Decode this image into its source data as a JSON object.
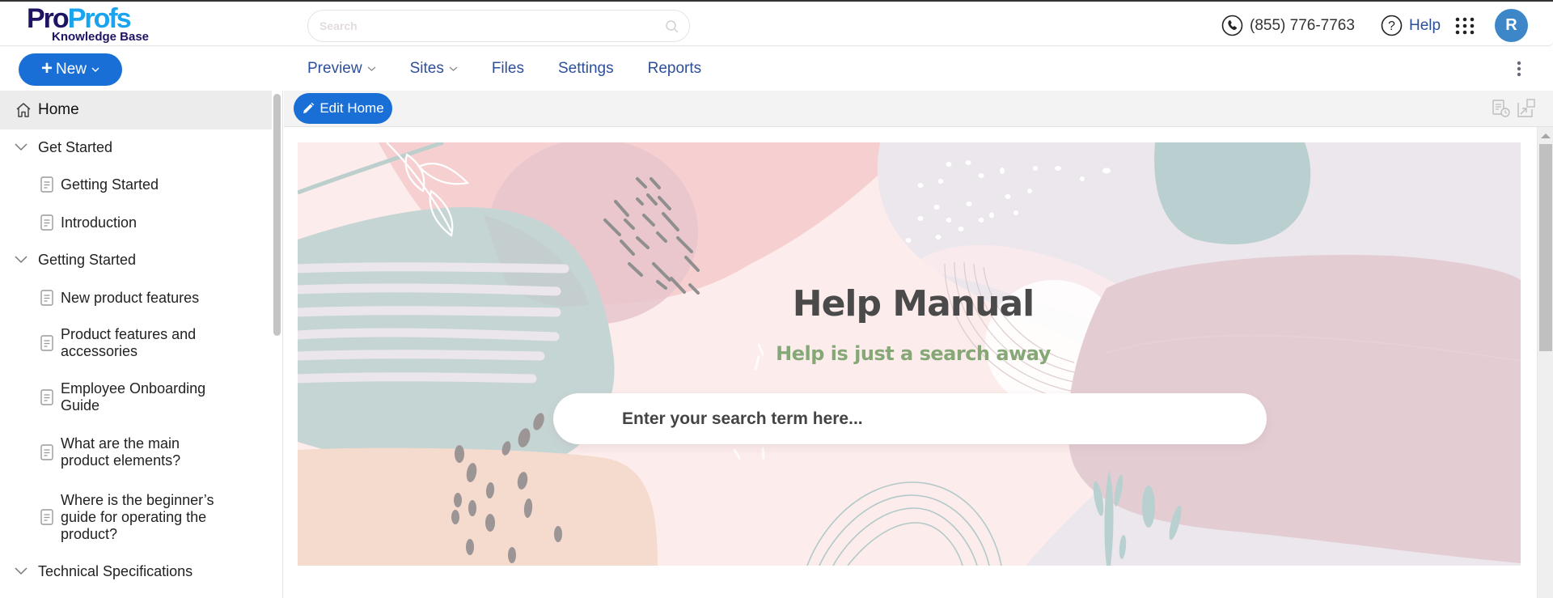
{
  "app": {
    "logo": {
      "part1": "Pro",
      "part2": "Profs",
      "subtitle": "Knowledge Base"
    },
    "brand_colors": {
      "primary_blue": "#1a6fd6",
      "nav_text": "#2d4f9a",
      "avatar": "#3d87c9",
      "logo_dark": "#1d1464",
      "logo_light": "#1aa3ef"
    }
  },
  "header": {
    "search": {
      "placeholder": "Search",
      "value": "",
      "icon": "search-icon"
    },
    "phone": {
      "icon": "phone-icon",
      "number": "(855) 776-7763"
    },
    "help": {
      "icon": "help-circle-icon",
      "label": "Help"
    },
    "apps_icon": "apps-grid-icon",
    "avatar": {
      "initial": "R"
    }
  },
  "toolbar": {
    "new_button": {
      "label": "New",
      "icon": "plus-icon"
    },
    "nav": [
      {
        "label": "Preview",
        "has_dropdown": true
      },
      {
        "label": "Sites",
        "has_dropdown": true
      },
      {
        "label": "Files",
        "has_dropdown": false
      },
      {
        "label": "Settings",
        "has_dropdown": false
      },
      {
        "label": "Reports",
        "has_dropdown": false
      }
    ],
    "more_icon": "kebab-menu-icon"
  },
  "sidebar": {
    "items": [
      {
        "type": "home",
        "label": "Home",
        "selected": true
      },
      {
        "type": "section",
        "label": "Get Started",
        "expanded": true
      },
      {
        "type": "article",
        "label": "Getting Started"
      },
      {
        "type": "article",
        "label": "Introduction"
      },
      {
        "type": "section",
        "label": "Getting Started",
        "expanded": true
      },
      {
        "type": "article",
        "label": "New product features"
      },
      {
        "type": "article",
        "label": "Product features and accessories"
      },
      {
        "type": "article",
        "label": "Employee Onboarding Guide"
      },
      {
        "type": "article",
        "label": "What are the main product elements?"
      },
      {
        "type": "article",
        "label": "Where is the beginner’s guide for operating the product?"
      },
      {
        "type": "section",
        "label": "Technical Specifications",
        "expanded": true
      }
    ]
  },
  "editbar": {
    "edit_button": {
      "label": "Edit Home",
      "icon": "pencil-icon"
    },
    "icons": [
      "revision-history-icon",
      "expand-icon"
    ]
  },
  "banner": {
    "title": "Help Manual",
    "subtitle": "Help is just a search away",
    "search_placeholder": "Enter your search term here...",
    "search_value": "",
    "title_color": "#4a4a4a",
    "subtitle_color": "#86a877"
  }
}
